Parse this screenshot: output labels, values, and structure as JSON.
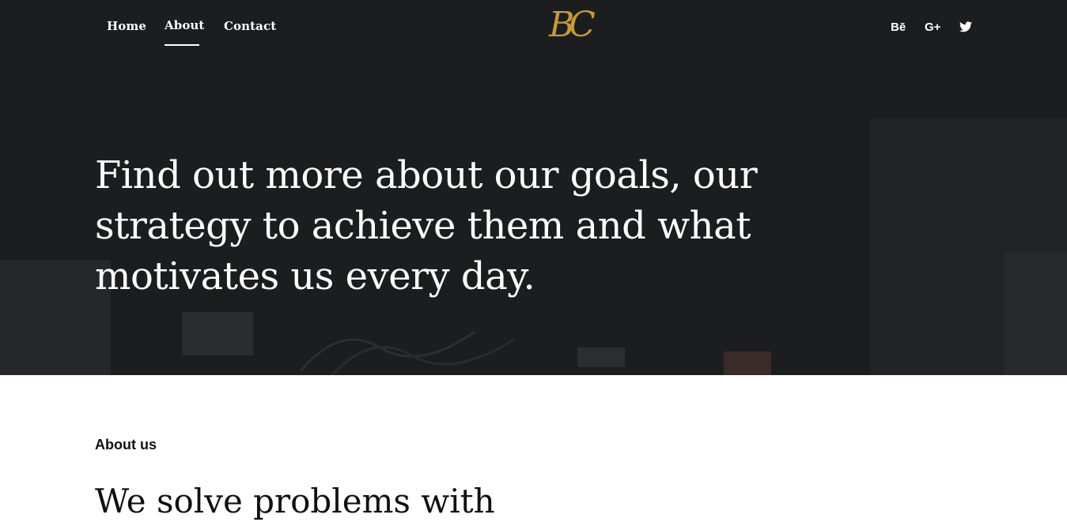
{
  "nav": {
    "items": [
      {
        "label": "Home",
        "active": false
      },
      {
        "label": "About",
        "active": true
      },
      {
        "label": "Contact",
        "active": false
      }
    ]
  },
  "logo": {
    "text": "BC",
    "color": "#c49a3c"
  },
  "social": {
    "behance": {
      "label": "Bē",
      "icon": "behance-icon"
    },
    "gplus": {
      "label": "G+",
      "icon": "google-plus-icon"
    },
    "twitter": {
      "icon": "twitter-icon"
    }
  },
  "hero": {
    "text": "Find out more about our goals, our strategy to achieve them and what motivates us every day."
  },
  "about": {
    "label": "About us",
    "heading": "We solve problems with"
  },
  "colors": {
    "hero_bg": "#1c1d1f",
    "accent": "#c49a3c",
    "text_dark": "#111111"
  }
}
